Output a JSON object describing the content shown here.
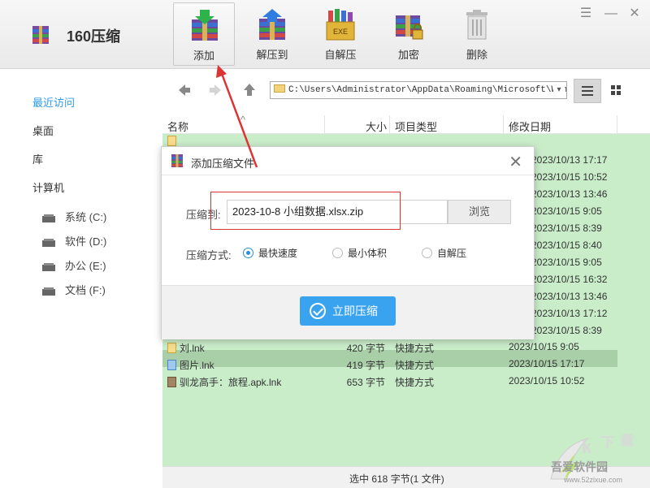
{
  "app": {
    "title": "160压缩"
  },
  "toolbar": {
    "items": [
      {
        "label": "添加"
      },
      {
        "label": "解压到"
      },
      {
        "label": "自解压",
        "badge": "EXE"
      },
      {
        "label": "加密"
      },
      {
        "label": "删除"
      }
    ]
  },
  "sidebar": {
    "nav": [
      "最近访问",
      "桌面",
      "库",
      "计算机"
    ],
    "drives": [
      "系统 (C:)",
      "软件 (D:)",
      "办公 (E:)",
      "文档 (F:)"
    ]
  },
  "address": {
    "path": "C:\\Users\\Administrator\\AppData\\Roaming\\Microsoft\\Windo"
  },
  "columns": {
    "name": "名称",
    "size": "大小",
    "type": "项目类型",
    "date": "修改日期"
  },
  "partial_dates": [
    "2023/10/13 17:17",
    "2023/10/15 10:52",
    "2023/10/13 13:46",
    "2023/10/15 9:05",
    "2023/10/15 8:39",
    "2023/10/15 8:40",
    "2023/10/15 9:05",
    "2023/10/15 16:32",
    "2023/10/13 13:46",
    "2023/10/13 17:12",
    "2023/10/15 8:39"
  ],
  "rows": [
    {
      "name": "刘.lnk",
      "size": "420 字节",
      "type": "快捷方式",
      "date": "2023/10/15 9:05"
    },
    {
      "name": "图片.lnk",
      "size": "419 字节",
      "type": "快捷方式",
      "date": "2023/10/15 17:17"
    },
    {
      "name": "驯龙高手：旅程.apk.lnk",
      "size": "653 字节",
      "type": "快捷方式",
      "date": "2023/10/15 10:52"
    }
  ],
  "status": {
    "text": "选中  618 字节(1 文件)"
  },
  "dialog": {
    "title": "添加压缩文件",
    "target_label": "压缩到:",
    "target_value": "2023-10-8 小组数据.xlsx.zip",
    "browse_label": "浏览",
    "method_label": "压缩方式:",
    "options": [
      {
        "label": "最快速度",
        "selected": true
      },
      {
        "label": "最小体积",
        "selected": false
      },
      {
        "label": "自解压",
        "selected": false
      }
    ],
    "submit_label": "立即压缩"
  },
  "watermark": {
    "text": "吾爱软件园",
    "url": "www.52zixue.com"
  },
  "colors": {
    "accent": "#3aa3ef",
    "list_bg": "#c9ecc9",
    "annotation": "#d33333"
  }
}
